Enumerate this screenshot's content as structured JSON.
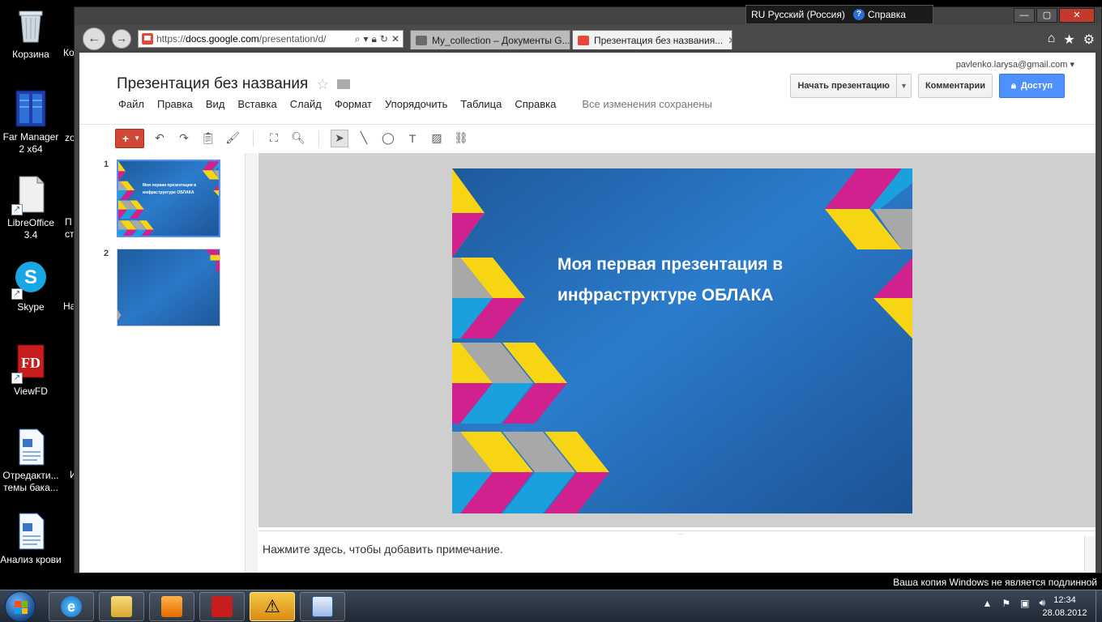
{
  "desktop": {
    "icons": [
      {
        "label": "Корзина"
      },
      {
        "label": "Far Manager 2 x64"
      },
      {
        "label": "LibreOffice 3.4"
      },
      {
        "label": "Skype"
      },
      {
        "label": "ViewFD"
      },
      {
        "label": "Отредакти... темы бака..."
      },
      {
        "label": "Анализ крови"
      }
    ],
    "clipped_labels": [
      "Ко",
      "zo",
      "П",
      "ст",
      "На",
      "И"
    ]
  },
  "language_bar": {
    "lang": "RU Русский (Россия)",
    "help": "Справка"
  },
  "browser": {
    "url_scheme": "https://",
    "url_host": "docs.google.com",
    "url_path": "/presentation/d/",
    "tabs": [
      {
        "title": "My_collection – Документы G..."
      },
      {
        "title": "Презентация без названия..."
      }
    ]
  },
  "app": {
    "account": "pavlenko.larysa@gmail.com",
    "title": "Презентация без названия",
    "menu": [
      "Файл",
      "Правка",
      "Вид",
      "Вставка",
      "Слайд",
      "Формат",
      "Упорядочить",
      "Таблица",
      "Справка"
    ],
    "save_status": "Все изменения сохранены",
    "start_presentation": "Начать презентацию",
    "comments": "Комментарии",
    "share": "Доступ",
    "slide_numbers": [
      "1",
      "2"
    ],
    "slide_title_line1": "Моя первая презентация в",
    "slide_title_line2": "инфраструктуре ОБЛАКА",
    "notes_placeholder": "Нажмите здесь, чтобы добавить примечание."
  },
  "watermark": "Ваша копия Windows не является подлинной",
  "taskbar": {
    "time": "12:34",
    "date": "28.08.2012"
  },
  "colors": {
    "slide_blue": "#2a66a8",
    "magenta": "#d0218f",
    "yellow": "#f7d414",
    "cyan": "#1aa0dc",
    "gray": "#a8a8a8",
    "accent_red": "#d14836",
    "accent_blue": "#4d90fe"
  }
}
